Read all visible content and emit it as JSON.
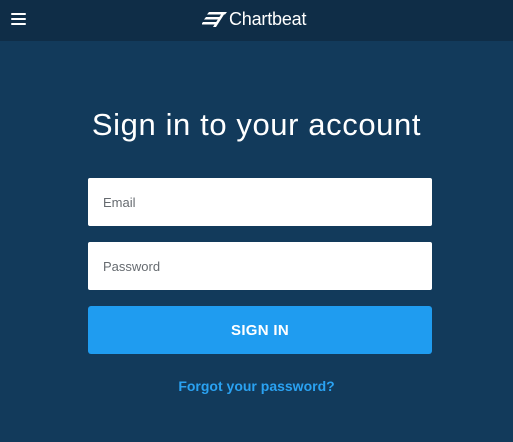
{
  "header": {
    "menu_icon": "hamburger-menu-icon",
    "logo_icon": "chartbeat-logo-mark",
    "logo_text": "Chartbeat"
  },
  "main": {
    "title": "Sign in to your account",
    "email": {
      "value": "",
      "placeholder": "Email"
    },
    "password": {
      "value": "",
      "placeholder": "Password"
    },
    "signin_label": "SIGN IN",
    "forgot_label": "Forgot your password?"
  },
  "colors": {
    "background": "#123a5b",
    "topbar": "#0f2d47",
    "button": "#1f9cf0",
    "link": "#2aa2f2"
  }
}
